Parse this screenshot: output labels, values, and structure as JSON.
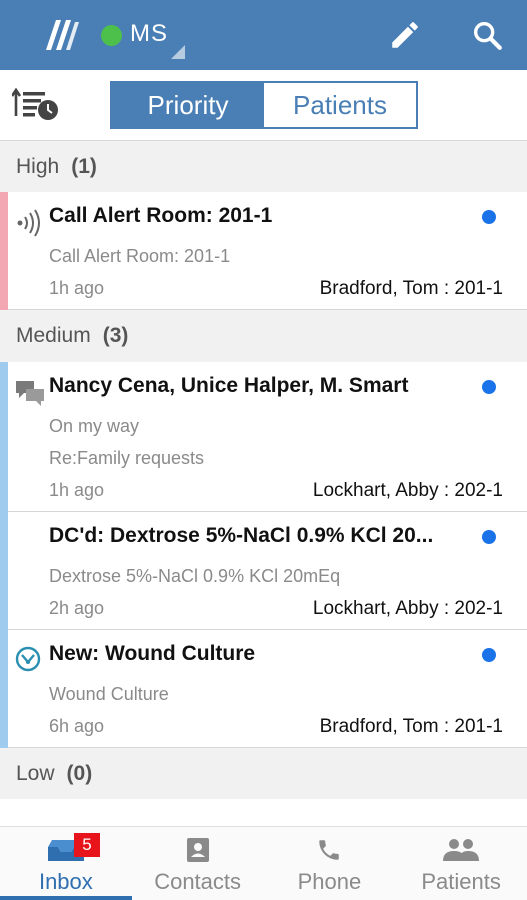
{
  "header": {
    "unit": "MS"
  },
  "segment": {
    "priority": "Priority",
    "patients": "Patients"
  },
  "sections": {
    "high": {
      "label": "High",
      "count": "(1)"
    },
    "medium": {
      "label": "Medium",
      "count": "(3)"
    },
    "low": {
      "label": "Low",
      "count": "(0)"
    }
  },
  "messages": [
    {
      "title": "Call Alert Room: 201-1",
      "line1": "Call Alert Room: 201-1",
      "time": "1h ago",
      "patient": "Bradford, Tom : 201-1",
      "icon": "call-alert-icon"
    },
    {
      "title": "Nancy Cena, Unice Halper, M. Smart",
      "line1": "On my way",
      "line2": "Re:Family requests",
      "time": "1h ago",
      "patient": "Lockhart, Abby : 202-1",
      "icon": "chat-icon"
    },
    {
      "title": "DC'd: Dextrose 5%-NaCl 0.9% KCl 20...",
      "line1": "Dextrose 5%-NaCl 0.9% KCl 20mEq",
      "time": "2h ago",
      "patient": "Lockhart, Abby : 202-1",
      "icon": ""
    },
    {
      "title": "New: Wound Culture",
      "line1": "Wound Culture",
      "time": "6h ago",
      "patient": "Bradford, Tom : 201-1",
      "icon": "lab-icon"
    }
  ],
  "nav": {
    "inbox": "Inbox",
    "inbox_badge": "5",
    "contacts": "Contacts",
    "phone": "Phone",
    "patients": "Patients"
  },
  "colors": {
    "header": "#4a7fb5",
    "status_online": "#4cc04a",
    "high_stripe": "#f2a7b3",
    "medium_stripe": "#9fcbee",
    "unread_dot": "#1a73e8",
    "badge": "#e8141c"
  }
}
